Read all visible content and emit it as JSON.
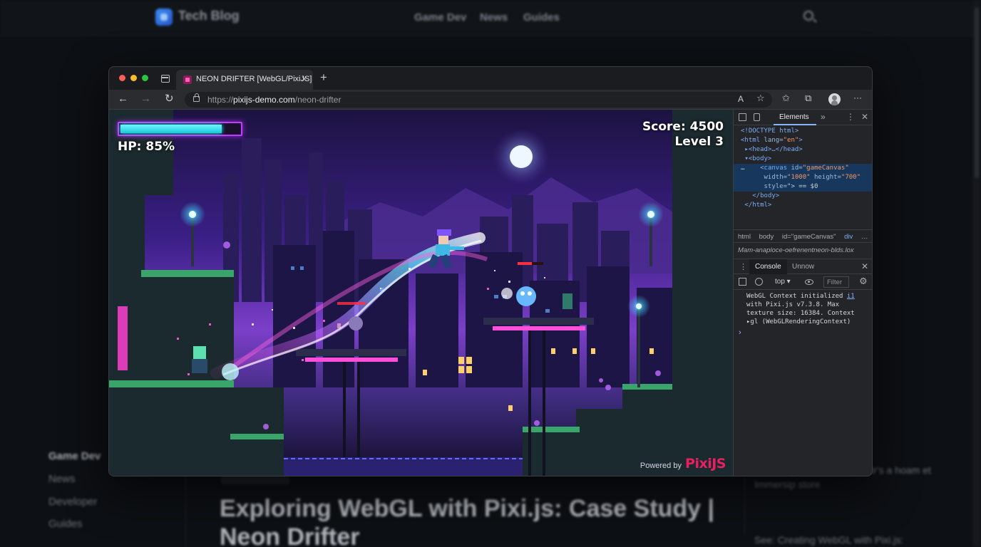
{
  "background_page": {
    "brand": "Tech Blog",
    "nav": [
      "Game Dev",
      "News",
      "Guides"
    ],
    "sidebar": [
      "Game Dev",
      "News",
      "Developer",
      "Guides"
    ],
    "article_title": "Exploring WebGL with Pixi.js: Case Study | Neon Drifter",
    "related": [
      "Exploring WebGL with Elixir's a hoam et Immersip store",
      "See: Creating WebGL with Pixi.js:"
    ]
  },
  "browser": {
    "tab_title": "NEON DRIFTER [WebGL/PixiJS]",
    "tab_close": "×",
    "new_tab": "+",
    "url_prefix": "https://",
    "url_domain": "pixijs-demo.com",
    "url_path": "/neon-drifter",
    "nav_back": "←",
    "nav_forward": "→",
    "nav_reload": "↻",
    "read_aloud": "A",
    "more": "···"
  },
  "game": {
    "hp_label": "HP: 85%",
    "hp_fraction": 0.85,
    "score": "Score: 4500",
    "level": "Level 3",
    "powered_by": "Powered by",
    "engine": "PixiJS"
  },
  "devtools": {
    "tab_elements": "Elements",
    "more_tabs": "»",
    "kebab": "⋮",
    "close": "✕",
    "dom": {
      "l1": "<!DOCTYPE html>",
      "l2_tag": "<html",
      "l2_attr": "lang=",
      "l2_val": "\"en\"",
      "l2_end": ">",
      "l3": "▸<head>…</head>",
      "l4": "▾<body>",
      "l5_dots": "…",
      "l5_tag": "<canvas",
      "l5_attr": "id=",
      "l5_val": "\"gameCanvas\"",
      "l6_attr1": "width=",
      "l6_val1": "\"1000\"",
      "l6_attr2": "height=",
      "l6_val2": "\"700\"",
      "l7_attr": "style=",
      "l7_rest": "\"> == $0",
      "l8": "</body>",
      "l9": "</html>"
    },
    "breadcrumb": [
      "html",
      "body",
      "id=\"gameCanvas\"",
      "div",
      "…"
    ],
    "styles_line": "Mam-anaploce-oefrenentneon-blds.lox",
    "console_tab": "Console",
    "console_other_tab": "Unnow",
    "context": "top ▾",
    "filter_placeholder": "Filter",
    "gear": "⚙",
    "log_line1": "WebGL Context initialized ",
    "log_link": "i1",
    "log_line2": "with Pixi.js v7.3.8. Max\ntexture size: 16384. Context\n▸gl (WebGLRenderingContext)",
    "prompt": "›"
  }
}
